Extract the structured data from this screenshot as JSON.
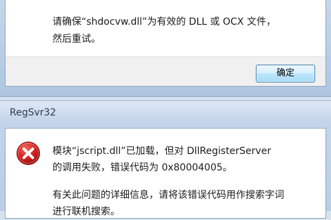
{
  "dialog_top": {
    "message_line1": "请确保“shdocvw.dll”为有效的 DLL 或 OCX 文件，",
    "message_line2": "然后重试。",
    "ok_button": "确定"
  },
  "dialog_regsvr": {
    "title": "RegSvr32",
    "icon": "error-icon",
    "message_line1": "模块“jscript.dll”已加载，但对 DllRegisterServer",
    "message_line2": "的调用失败，错误代码为 0x80004005。",
    "message_line3": "有关此问题的详细信息，请将该错误代码用作搜索字词",
    "message_line4": "进行联机搜索。"
  }
}
